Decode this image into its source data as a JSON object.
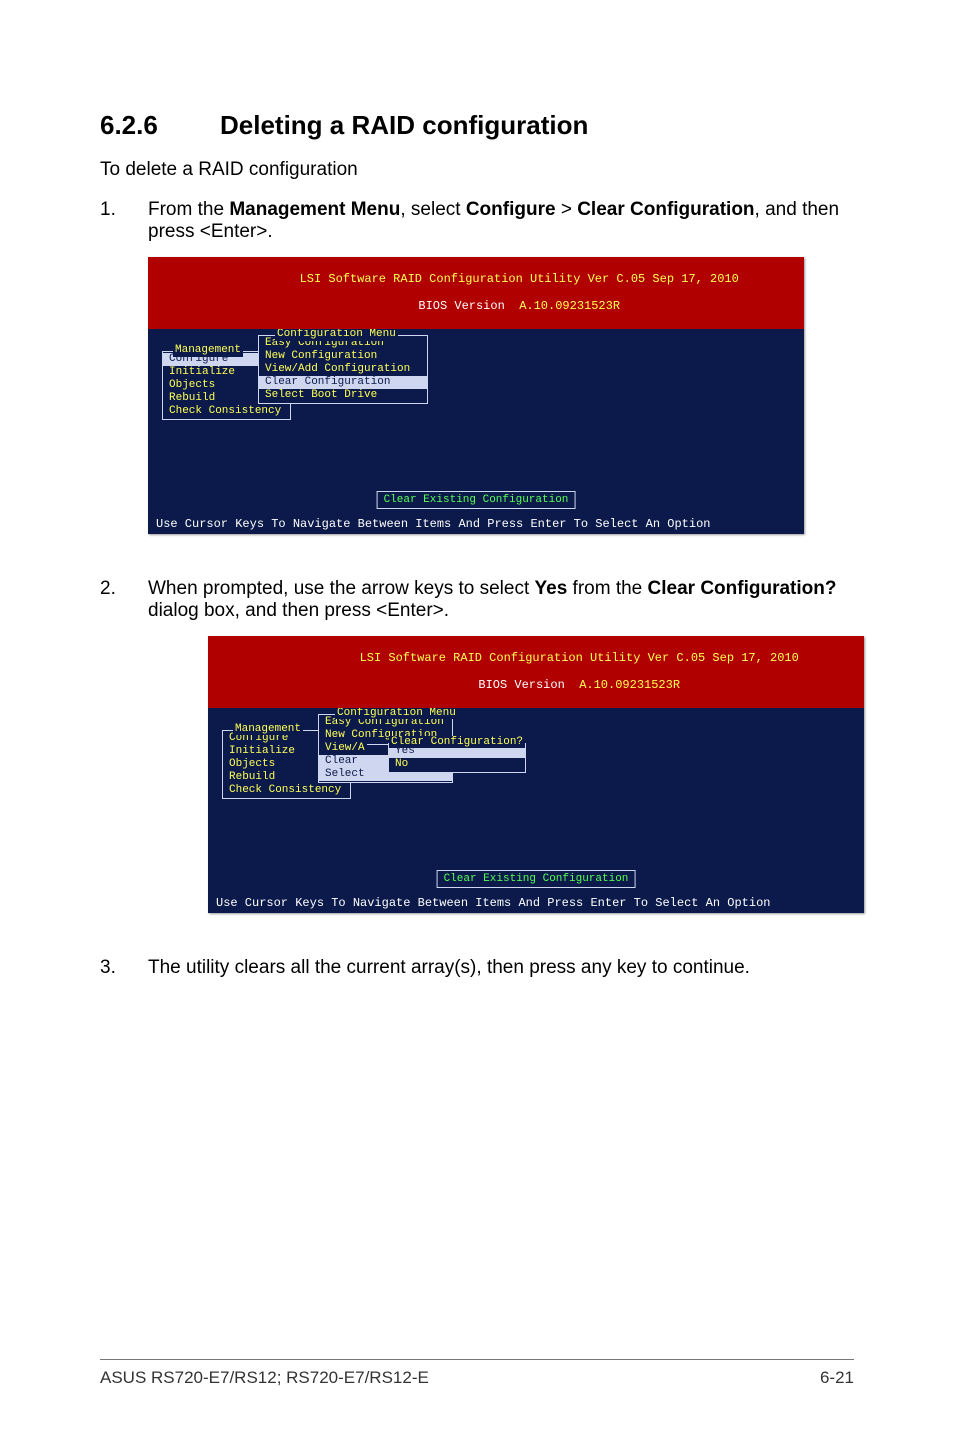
{
  "heading": {
    "number": "6.2.6",
    "title": "Deleting a RAID configuration"
  },
  "intro": "To delete a RAID configuration",
  "steps": {
    "s1": {
      "num": "1.",
      "pre": "From the ",
      "b1": "Management Menu",
      "mid1": ", select ",
      "b2": "Configure",
      "mid2": " > ",
      "b3": "Clear Configuration",
      "post": ", and then press <Enter>."
    },
    "s2": {
      "num": "2.",
      "pre": "When prompted, use the arrow keys to select ",
      "b1": "Yes",
      "mid1": " from the ",
      "b2": "Clear Configuration?",
      "post": " dialog box, and then press <Enter>."
    },
    "s3": {
      "num": "3.",
      "text": "The utility clears all the current array(s), then press any key to continue."
    }
  },
  "bios": {
    "title_line1": "LSI Software RAID Configuration Utility Ver C.05 Sep 17, 2010",
    "title_line2a": "BIOS Version  ",
    "title_line2b": "A.10.09231523R",
    "footer_text": "Use Cursor Keys To Navigate Between Items And Press Enter To Select An Option",
    "status_text": "Clear Existing Configuration",
    "mgmt_label": "Management",
    "mgmt_items": [
      "Configure",
      "Initialize",
      "Objects",
      "Rebuild",
      "Check Consistency"
    ],
    "cfg_label": "Configuration Menu",
    "cfg_items": [
      "Easy Configuration",
      "New Configuration",
      "View/Add Configuration",
      "Clear Configuration",
      "Select Boot Drive"
    ],
    "cfg_items_short": [
      "Easy Configuration",
      "New Configuration",
      "View/A",
      "Clear",
      "Select"
    ],
    "dlg_label": "Clear Configuration?",
    "dlg_items": [
      "Yes",
      "No"
    ]
  },
  "footer": {
    "left": "ASUS RS720-E7/RS12; RS720-E7/RS12-E",
    "right": "6-21"
  }
}
